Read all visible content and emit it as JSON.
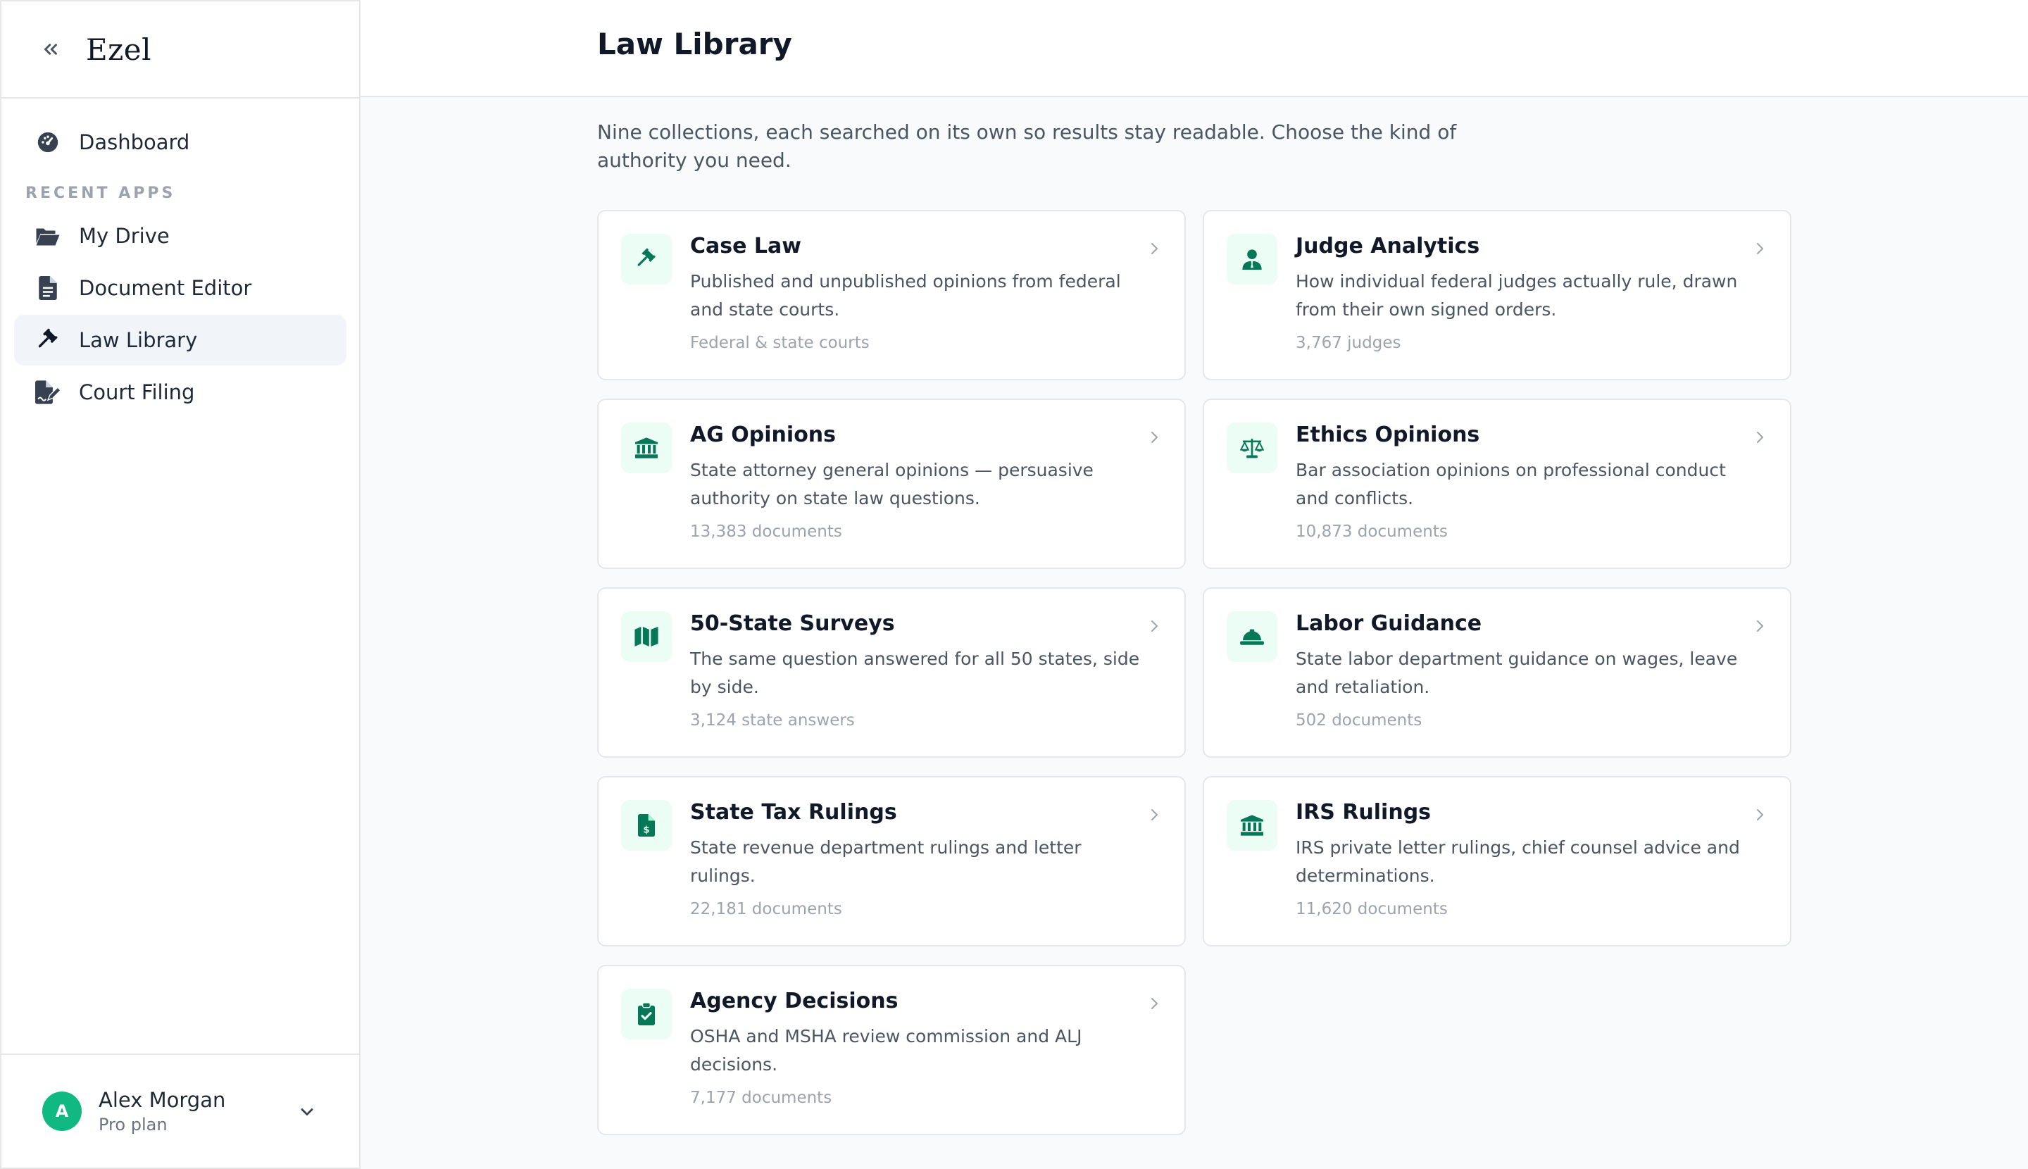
{
  "app": {
    "name": "Ezel"
  },
  "sidebar": {
    "dashboard_label": "Dashboard",
    "section_title": "RECENT APPS",
    "items": [
      {
        "label": "My Drive",
        "icon": "folder-open-icon"
      },
      {
        "label": "Document Editor",
        "icon": "file-text-icon"
      },
      {
        "label": "Law Library",
        "icon": "gavel-icon",
        "active": true
      },
      {
        "label": "Court Filing",
        "icon": "file-signature-icon"
      }
    ]
  },
  "user": {
    "initial": "A",
    "name": "Alex Morgan",
    "plan": "Pro plan"
  },
  "page": {
    "title": "Law Library",
    "intro": "Nine collections, each searched on its own so results stay readable. Choose the kind of authority you need."
  },
  "collections": [
    {
      "title": "Case Law",
      "desc": "Published and unpublished opinions from federal and state courts.",
      "meta": "Federal & state courts",
      "icon": "gavel-icon"
    },
    {
      "title": "Judge Analytics",
      "desc": "How individual federal judges actually rule, drawn from their own signed orders.",
      "meta": "3,767 judges",
      "icon": "user-tie-icon"
    },
    {
      "title": "AG Opinions",
      "desc": "State attorney general opinions — persuasive authority on state law questions.",
      "meta": "13,383 documents",
      "icon": "landmark-icon"
    },
    {
      "title": "Ethics Opinions",
      "desc": "Bar association opinions on professional conduct and conflicts.",
      "meta": "10,873 documents",
      "icon": "scale-icon"
    },
    {
      "title": "50-State Surveys",
      "desc": "The same question answered for all 50 states, side by side.",
      "meta": "3,124 state answers",
      "icon": "map-icon"
    },
    {
      "title": "Labor Guidance",
      "desc": "State labor department guidance on wages, leave and retaliation.",
      "meta": "502 documents",
      "icon": "hard-hat-icon"
    },
    {
      "title": "State Tax Rulings",
      "desc": "State revenue department rulings and letter rulings.",
      "meta": "22,181 documents",
      "icon": "file-invoice-dollar-icon"
    },
    {
      "title": "IRS Rulings",
      "desc": "IRS private letter rulings, chief counsel advice and determinations.",
      "meta": "11,620 documents",
      "icon": "landmark-icon"
    },
    {
      "title": "Agency Decisions",
      "desc": "OSHA and MSHA review commission and ALJ decisions.",
      "meta": "7,177 documents",
      "icon": "clipboard-check-icon"
    }
  ],
  "colors": {
    "accent": "#047857",
    "accent_bg": "#ecfdf5",
    "avatar": "#10b981"
  }
}
